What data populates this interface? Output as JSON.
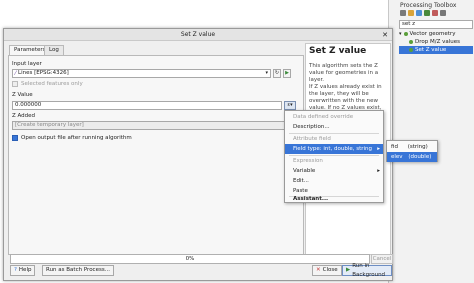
{
  "toolbox": {
    "title": "Processing Toolbox",
    "search": "set z",
    "tree": [
      {
        "label": "Vector geometry",
        "selected": false
      },
      {
        "label": "Drop M/Z values",
        "selected": false
      },
      {
        "label": "Set Z value",
        "selected": true
      }
    ]
  },
  "dialog": {
    "title": "Set Z value",
    "close_icon": "close-icon",
    "tabs": [
      "Parameters",
      "Log"
    ],
    "input_layer_label": "Input layer",
    "input_layer_value": "Lines [EPSG:4326]",
    "selected_only_label": "Selected features only",
    "z_value_label": "Z Value",
    "z_value": "0.000000",
    "z_added_label": "Z Added",
    "z_added_placeholder": "[Create temporary layer]",
    "open_output_label": "Open output file after running algorithm",
    "open_output_checked": true
  },
  "help": {
    "title": "Set Z value",
    "paragraph1": "This algorithm sets the Z value for geometries in a layer.",
    "paragraph2": "If Z values already exist in the layer, they will be overwritten with the new value. If no Z values exist, the geometry will be upgraded to include"
  },
  "menu": {
    "items": [
      {
        "label": "Data defined override",
        "disabled": true
      },
      {
        "label": "Description...",
        "disabled": false
      },
      {
        "label": "Attribute field",
        "disabled": true
      },
      {
        "label": "Field type: int, double, string",
        "disabled": false,
        "highlight": true
      },
      {
        "label": "Expression",
        "disabled": true
      },
      {
        "label": "Variable",
        "disabled": false
      },
      {
        "label": "Edit...",
        "disabled": false
      },
      {
        "label": "Paste",
        "disabled": false
      },
      {
        "label": "Assistant...",
        "disabled": false
      }
    ]
  },
  "submenu": {
    "items": [
      {
        "label": "fid",
        "type": "(string)",
        "highlight": false
      },
      {
        "label": "elev",
        "type": "(double)",
        "highlight": true
      }
    ]
  },
  "footer": {
    "progress_text": "0%",
    "progress_value": 0,
    "cancel": "Cancel",
    "help": "Help",
    "batch": "Run as Batch Process...",
    "close": "Close",
    "run_bg": "Run in Background"
  },
  "colors": {
    "accent": "#3875d7"
  }
}
